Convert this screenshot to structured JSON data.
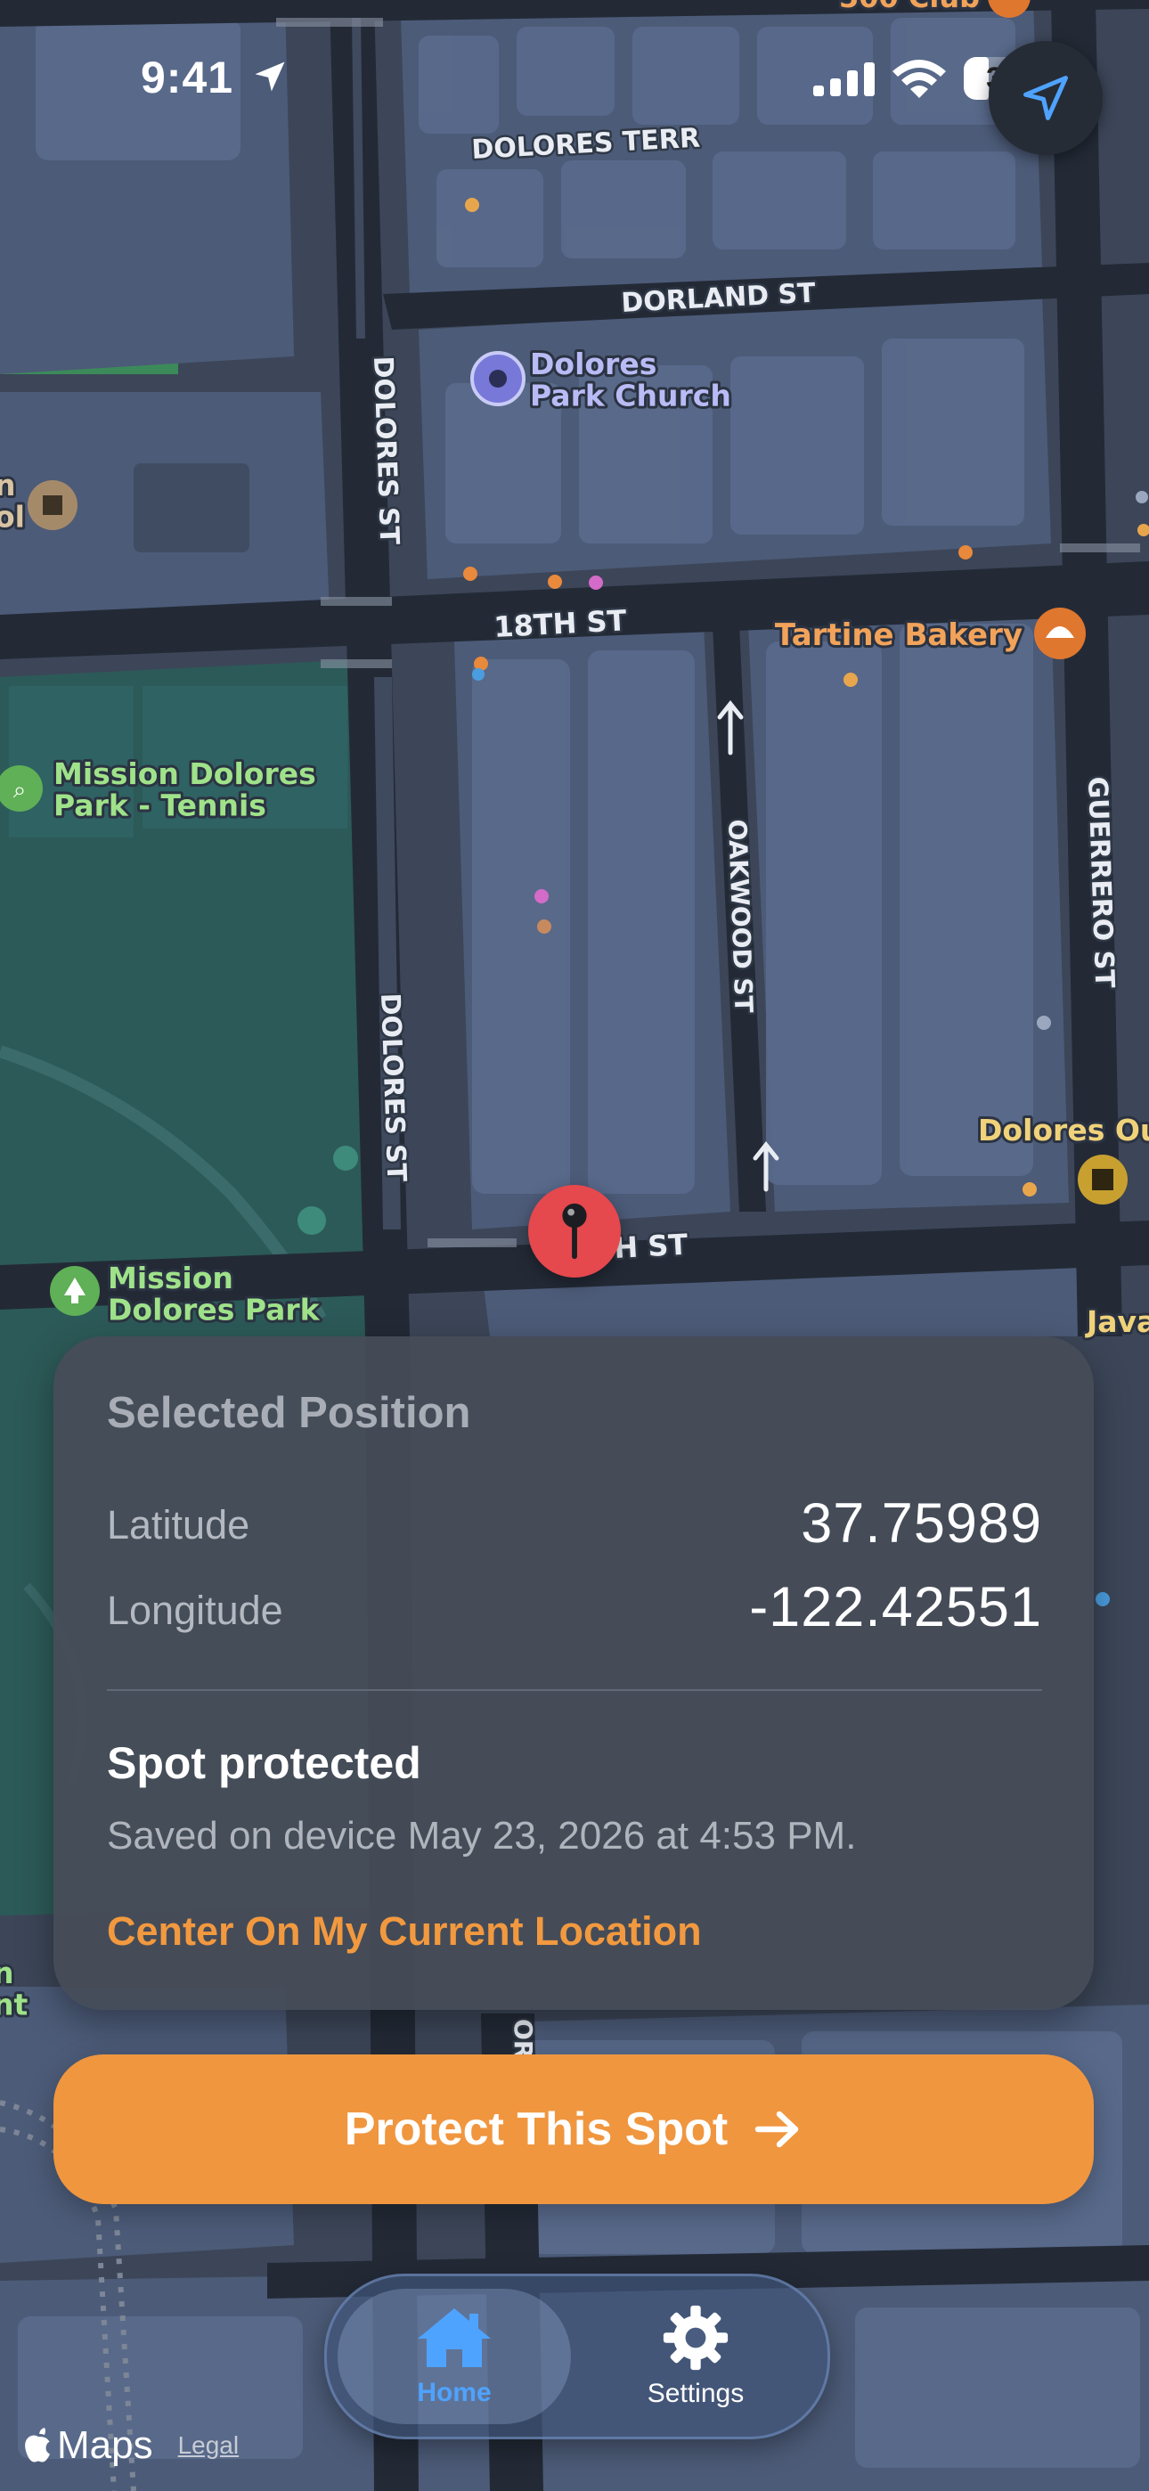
{
  "status_bar": {
    "time": "9:41",
    "battery": "32"
  },
  "map": {
    "street_labels": {
      "dolores_terr": "DOLORES TERR",
      "dorland_st": "DORLAND ST",
      "dolores_st_top": "DOLORES ST",
      "eighteenth_st": "18TH ST",
      "oakwood_st": "OAKWOOD ST",
      "guerrero_st": "GUERRERO ST",
      "dolores_st_bottom": "DOLORES ST",
      "partial_19th_st": "H ST",
      "partial_bottom_street": "OR"
    },
    "pois": {
      "top_club": "500 Club",
      "church": "Dolores\nPark Church",
      "bakery": "Tartine Bakery",
      "tennis": "Mission Dolores\nPark - Tennis",
      "park": "Mission\nDolores Park",
      "outlet": "Dolores Out",
      "java": "Java",
      "school_left": "n\nol",
      "left_bottom": "n\nnt"
    }
  },
  "card": {
    "title": "Selected Position",
    "latitude_label": "Latitude",
    "latitude_value": "37.75989",
    "longitude_label": "Longitude",
    "longitude_value": "-122.42551",
    "status_title": "Spot protected",
    "status_detail": "Saved on device May 23, 2026 at 4:53 PM.",
    "center_link": "Center On My Current Location"
  },
  "protect_button": {
    "label": "Protect This Spot"
  },
  "tabbar": {
    "home_label": "Home",
    "settings_label": "Settings"
  },
  "attribution": {
    "maps": "Maps",
    "legal": "Legal"
  },
  "colors": {
    "accent_orange": "#f0963f",
    "pin_red": "#e5484d",
    "active_tab_blue": "#4ea3ff"
  }
}
